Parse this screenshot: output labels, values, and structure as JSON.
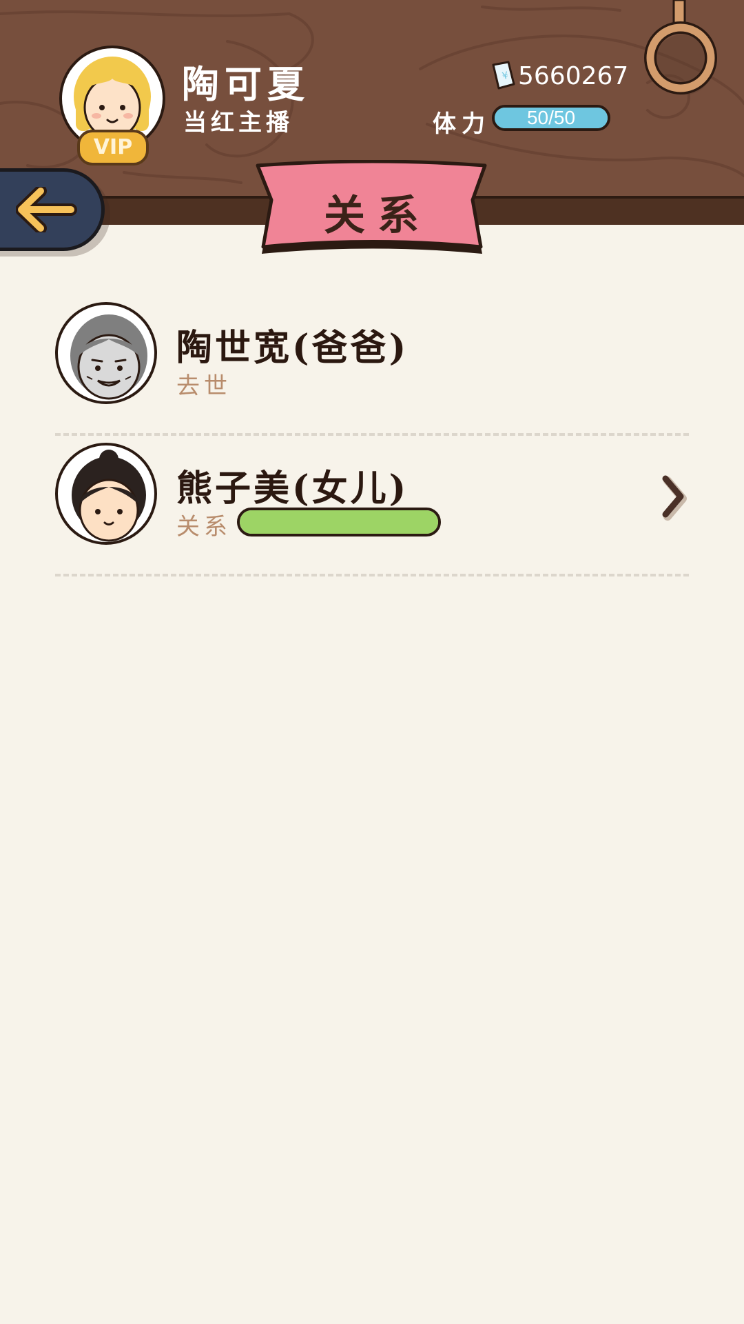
{
  "player": {
    "name": "陶可夏",
    "title": "当红主播",
    "vip_label": "VIP",
    "money_icon": "banknote-icon",
    "money": "5660267",
    "stamina_label": "体力",
    "stamina_text": "50/50",
    "stamina_fraction": 1.0
  },
  "page": {
    "title": "关系",
    "back_icon": "back-arrow-icon"
  },
  "relations": [
    {
      "name": "陶世宽(爸爸)",
      "status": "去世",
      "avatar_icon": "elderly-man-avatar-icon"
    },
    {
      "name": "熊子美(女儿)",
      "status": "关系",
      "bond_fraction": 1.0,
      "avatar_icon": "girl-avatar-icon",
      "chevron_icon": "chevron-right-icon"
    }
  ],
  "colors": {
    "header_wood": "#774f3d",
    "banner_pink": "#f08496",
    "background": "#f7f3ea",
    "stamina_blue": "#6ec6e0",
    "bond_green": "#9dd465",
    "back_button": "#33405a",
    "arrow_yellow": "#f7c25a"
  }
}
